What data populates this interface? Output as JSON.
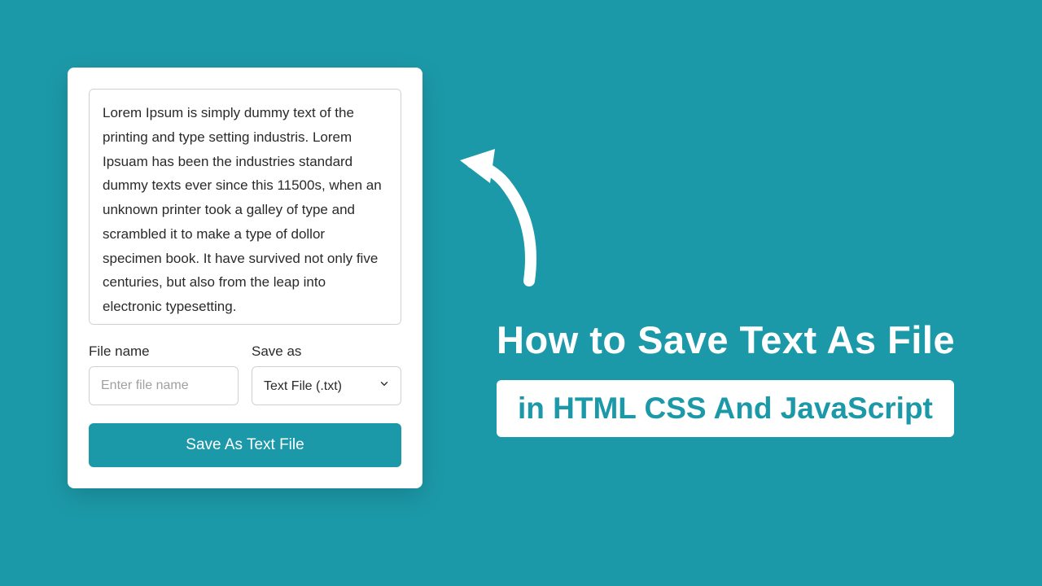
{
  "card": {
    "textarea_value": "Lorem Ipsum is simply dummy text of the printing and type setting industris. Lorem Ipsuam has been the industries standard dummy texts ever since this 11500s, when an unknown printer took a galley of type and scrambled it to make a type of dollor specimen book. It have survived not only five centuries, but also from the leap into electronic typesetting.",
    "filename_label": "File name",
    "filename_placeholder": "Enter file name",
    "filename_value": "",
    "saveas_label": "Save as",
    "saveas_selected": "Text File (.txt)",
    "button_label": "Save As Text File"
  },
  "promo": {
    "headline": "How to Save Text As File",
    "subtitle": "in HTML CSS And JavaScript"
  }
}
